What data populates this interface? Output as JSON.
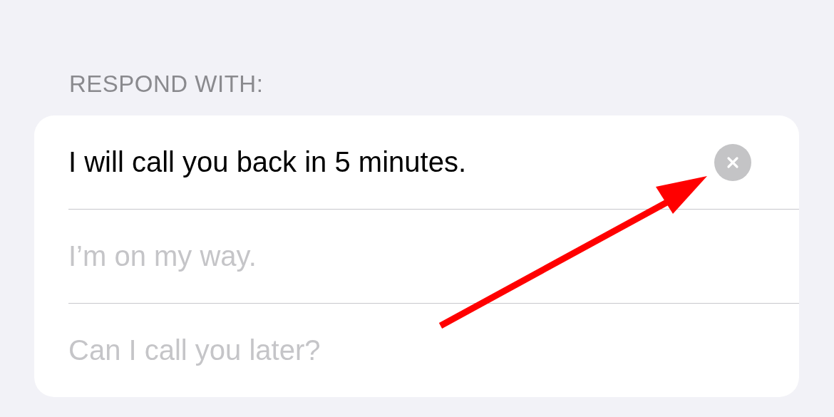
{
  "section_header": "RESPOND WITH:",
  "responses": [
    {
      "value": "I will call you back in 5 minutes.",
      "clear_button": true
    },
    {
      "placeholder": "I’m on my way.",
      "clear_button": false
    },
    {
      "placeholder": "Can I call you later?",
      "clear_button": false
    }
  ]
}
